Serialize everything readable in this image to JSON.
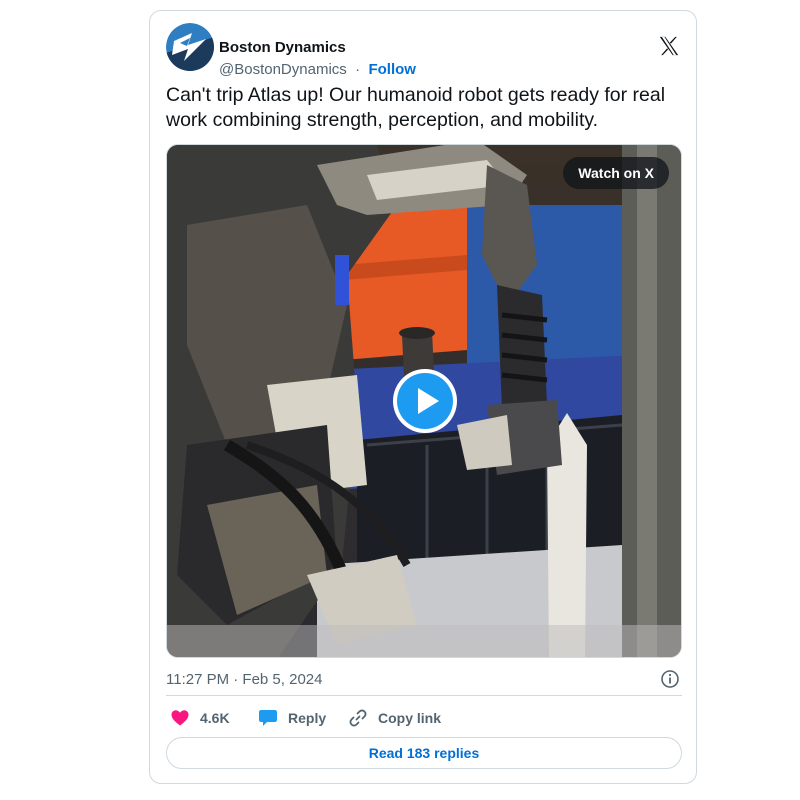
{
  "account": {
    "name": "Boston Dynamics",
    "handle": "@BostonDynamics",
    "separator": "·",
    "follow_label": "Follow",
    "avatar_icon": "boston-dynamics-logo",
    "platform_icon": "x-logo"
  },
  "tweet": {
    "text": "Can't trip Atlas up! Our humanoid robot gets ready for real work combining strength, perception, and mobility."
  },
  "media": {
    "type": "video",
    "watch_label": "Watch on X",
    "play_icon": "play-icon"
  },
  "meta": {
    "timestamp": "11:27 PM · Feb 5, 2024",
    "info_icon": "info-icon"
  },
  "actions": {
    "likes_count": "4.6K",
    "reply_label": "Reply",
    "copy_link_label": "Copy link"
  },
  "read_replies_label": "Read 183 replies",
  "colors": {
    "accent": "#006fd6",
    "text": "#0f1419",
    "secondary": "#536471",
    "border": "#cfd9de",
    "heart": "#f91880",
    "reply_bubble": "#1d9bf0",
    "play_button": "#1d9bf0"
  }
}
